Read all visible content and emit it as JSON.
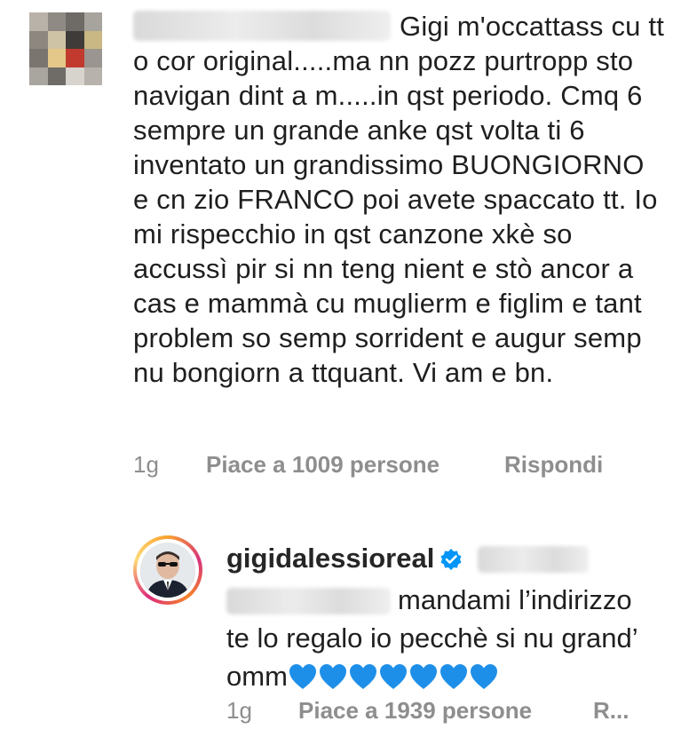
{
  "comment": {
    "text": "Gigi m'occattass cu tt o cor original.....ma nn pozz purtropp sto navigan dint a m.....in qst periodo. Cmq 6 sempre un grande anke qst volta ti 6 inventato un grandissimo BUONGIORNO e cn zio FRANCO poi avete spaccato tt. Io mi rispecchio in qst canzone xkè so accussì pir si nn teng nient e stò ancor a cas e mammà cu muglierm e figlim e tant problem so semp sorrident e augur semp nu bongiorn a ttquant. Vi am e bn.",
    "time": "1g",
    "likes": "Piace a 1009 persone",
    "reply_label": "Rispondi"
  },
  "reply": {
    "username": "gigidalessioreal",
    "text": "mandami l’indirizzo te lo regalo io pecchè si nu grand’ omm",
    "heart_count": 7,
    "time": "1g",
    "likes": "Piace a 1939 persone",
    "reply_label": "R..."
  },
  "colors": {
    "accent_blue": "#0095f6",
    "heart_blue": "#1e8fe8",
    "meta_gray": "#8e8e8e"
  },
  "icons": {
    "verified": "verified-badge-icon",
    "heart": "blue-heart-emoji"
  }
}
